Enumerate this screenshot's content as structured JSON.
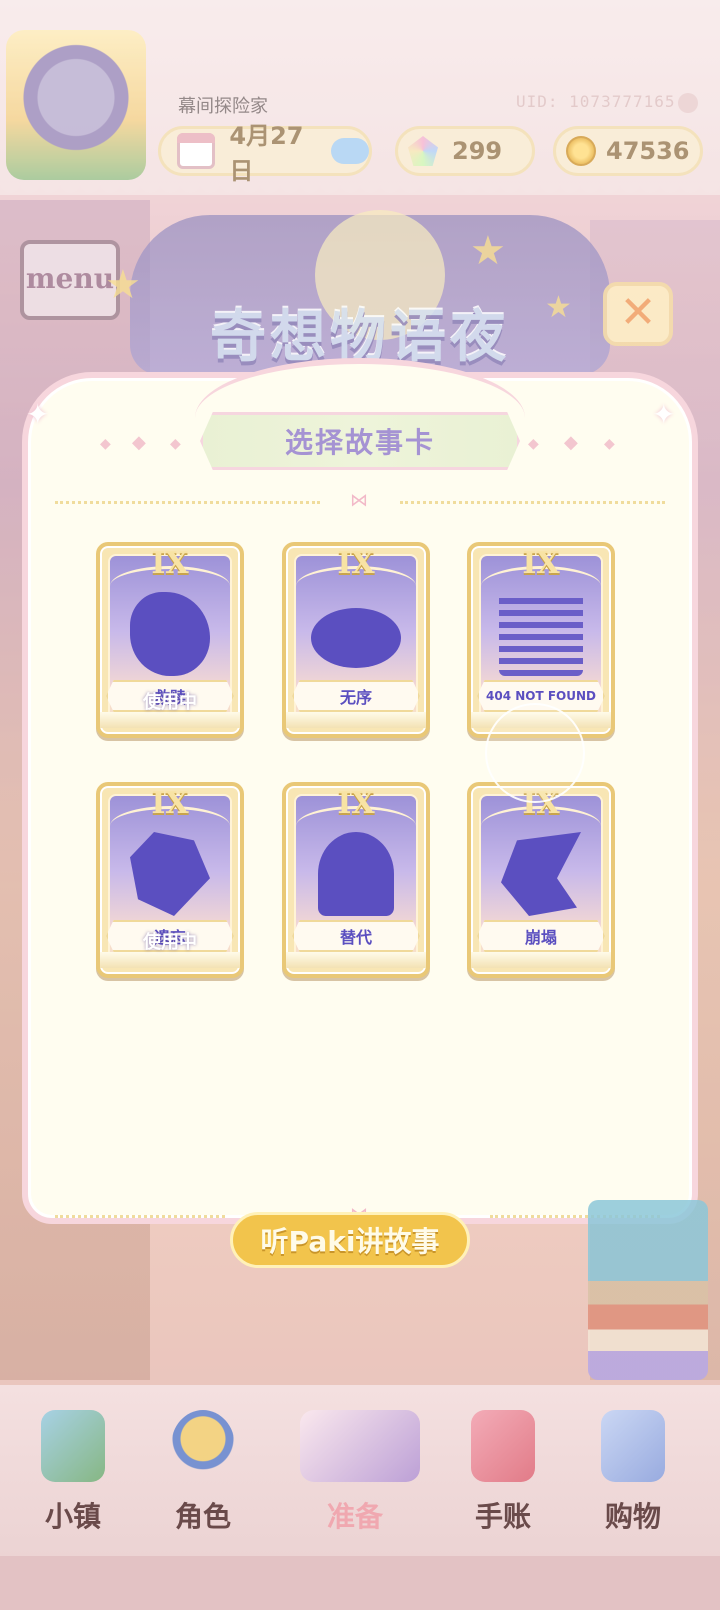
{
  "header": {
    "player_name": "幕间探险家",
    "uid_label": "UID: 1073777165",
    "date": "4月27日",
    "gems": "299",
    "coins": "47536"
  },
  "banner": {
    "title": "奇想物语夜",
    "menu_sign": "menu"
  },
  "modal": {
    "title": "选择故事卡",
    "cards": [
      {
        "roman": "IX",
        "label": "救赎",
        "status": "使用中"
      },
      {
        "roman": "IX",
        "label": "无序",
        "status": ""
      },
      {
        "roman": "IX",
        "label": "404 NOT FOUND",
        "status": ""
      },
      {
        "roman": "IX",
        "label": "遗忘",
        "status": "使用中"
      },
      {
        "roman": "IX",
        "label": "替代",
        "status": ""
      },
      {
        "roman": "IX",
        "label": "崩塌",
        "status": ""
      }
    ]
  },
  "story_button": "听Paki讲故事",
  "nav": {
    "items": [
      {
        "label": "小镇",
        "icon": "map-icon"
      },
      {
        "label": "角色",
        "icon": "character-icon"
      },
      {
        "label": "准备",
        "icon": "prepare-icon"
      },
      {
        "label": "手账",
        "icon": "journal-icon"
      },
      {
        "label": "购物",
        "icon": "shopping-bag-icon"
      }
    ]
  },
  "colors": {
    "accent_purple": "#5b4fc0",
    "title_purple": "#a593d3",
    "gold": "#e9c877",
    "modal_bg": "#fffdf0"
  }
}
